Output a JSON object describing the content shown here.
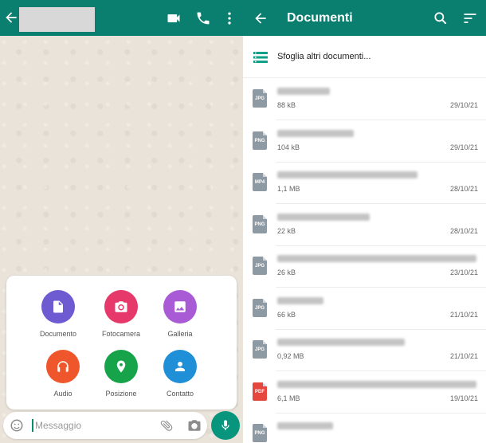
{
  "chat": {
    "attach_items": [
      {
        "label": "Documento",
        "color": "#6e5ad1"
      },
      {
        "label": "Fotocamera",
        "color": "#e6386b"
      },
      {
        "label": "Galleria",
        "color": "#a95bd6"
      },
      {
        "label": "Audio",
        "color": "#f0562b"
      },
      {
        "label": "Posizione",
        "color": "#16a34a"
      },
      {
        "label": "Contatto",
        "color": "#1f90d8"
      }
    ],
    "message_placeholder": "Messaggio",
    "accent_color": "#0b7f6f"
  },
  "documents": {
    "title": "Documenti",
    "browse_label": "Sfoglia altri documenti...",
    "files": [
      {
        "ext": "JPG",
        "size": "88 kB",
        "date": "29/10/21"
      },
      {
        "ext": "PNG",
        "size": "104 kB",
        "date": "29/10/21"
      },
      {
        "ext": "MP4",
        "size": "1,1 MB",
        "date": "28/10/21"
      },
      {
        "ext": "PNG",
        "size": "22 kB",
        "date": "28/10/21"
      },
      {
        "ext": "JPG",
        "size": "26 kB",
        "date": "23/10/21"
      },
      {
        "ext": "JPG",
        "size": "66 kB",
        "date": "21/10/21"
      },
      {
        "ext": "JPG",
        "size": "0,92 MB",
        "date": "21/10/21"
      },
      {
        "ext": "PDF",
        "size": "6,1 MB",
        "date": "19/10/21"
      },
      {
        "ext": "PNG",
        "size": "",
        "date": ""
      }
    ]
  }
}
